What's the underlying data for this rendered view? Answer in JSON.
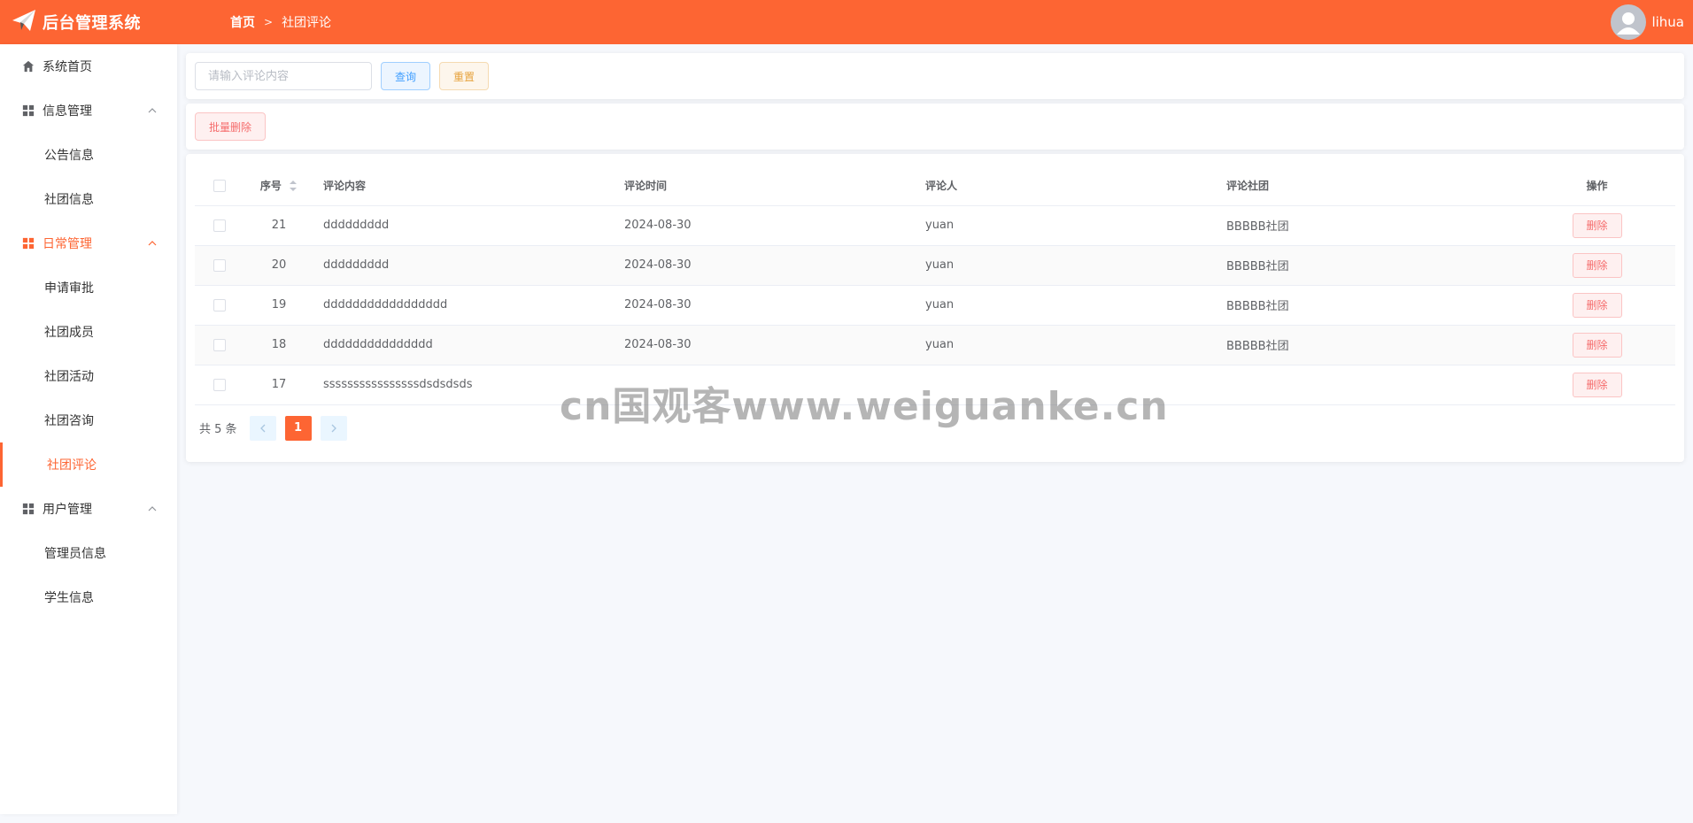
{
  "header": {
    "app_title": "后台管理系统",
    "breadcrumb_home": "首页",
    "breadcrumb_separator": ">",
    "breadcrumb_current": "社团评论",
    "username": "lihua",
    "color": "#fd6533"
  },
  "sidebar": {
    "items": [
      {
        "label": "系统首页",
        "icon": "home-icon"
      },
      {
        "label": "信息管理",
        "icon": "grid-icon"
      },
      {
        "label": "公告信息"
      },
      {
        "label": "社团信息"
      },
      {
        "label": "日常管理",
        "icon": "grid-icon"
      },
      {
        "label": "申请审批"
      },
      {
        "label": "社团成员"
      },
      {
        "label": "社团活动"
      },
      {
        "label": "社团咨询"
      },
      {
        "label": "社团评论"
      },
      {
        "label": "用户管理",
        "icon": "grid-icon"
      },
      {
        "label": "管理员信息"
      },
      {
        "label": "学生信息"
      }
    ]
  },
  "search": {
    "placeholder": "请输入评论内容",
    "query_label": "查询",
    "reset_label": "重置"
  },
  "actions": {
    "batch_delete_label": "批量删除"
  },
  "table": {
    "headers": {
      "num": "序号",
      "content": "评论内容",
      "time": "评论时间",
      "user": "评论人",
      "club": "评论社团",
      "op": "操作"
    },
    "delete_label": "删除",
    "rows": [
      {
        "num": "21",
        "content": "ddddddddd",
        "time": "2024-08-30",
        "user": "yuan",
        "club": "BBBBB社团"
      },
      {
        "num": "20",
        "content": "ddddddddd",
        "time": "2024-08-30",
        "user": "yuan",
        "club": "BBBBB社团"
      },
      {
        "num": "19",
        "content": "ddddddddddddddddd",
        "time": "2024-08-30",
        "user": "yuan",
        "club": "BBBBB社团"
      },
      {
        "num": "18",
        "content": "ddddddddddddddd",
        "time": "2024-08-30",
        "user": "yuan",
        "club": "BBBBB社团"
      },
      {
        "num": "17",
        "content": "ssssssssssssssssdsdsdsds",
        "time": "",
        "user": "",
        "club": ""
      }
    ]
  },
  "pagination": {
    "total_text": "共 5 条",
    "current_page": "1"
  },
  "watermark": "cn国观客www.weiguanke.cn"
}
